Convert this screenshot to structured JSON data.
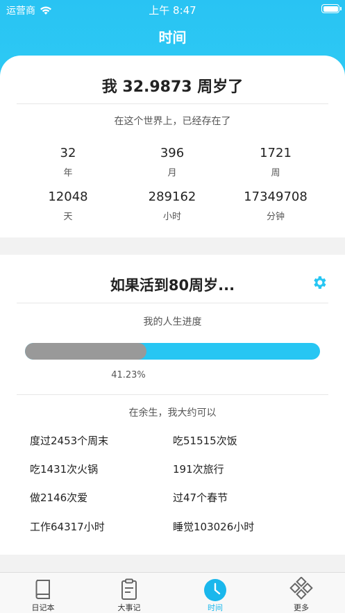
{
  "status_bar": {
    "carrier": "运营商",
    "time": "上午 8:47"
  },
  "nav": {
    "title": "时间"
  },
  "age_card": {
    "title": "我 32.9873 周岁了",
    "subtitle": "在这个世界上，已经存在了",
    "stats": [
      {
        "value": "32",
        "unit": "年"
      },
      {
        "value": "396",
        "unit": "月"
      },
      {
        "value": "1721",
        "unit": "周"
      },
      {
        "value": "12048",
        "unit": "天"
      },
      {
        "value": "289162",
        "unit": "小时"
      },
      {
        "value": "17349708",
        "unit": "分钟"
      }
    ]
  },
  "life_card": {
    "title": "如果活到80周岁...",
    "progress_label": "我的人生进度",
    "progress_percent": 41.23,
    "progress_text": "41.23%",
    "remaining_label": "在余生，我大约可以",
    "activities": [
      "度过2453个周末",
      "吃51515次饭",
      "吃1431次火锅",
      "191次旅行",
      "做2146次爱",
      "过47个春节",
      "工作64317小时",
      "睡觉103026小时"
    ]
  },
  "tabbar": {
    "tabs": [
      {
        "label": "日记本",
        "icon": "notebook-icon"
      },
      {
        "label": "大事记",
        "icon": "clipboard-icon"
      },
      {
        "label": "时间",
        "icon": "clock-icon"
      },
      {
        "label": "更多",
        "icon": "grid-diamond-icon"
      }
    ],
    "active_index": 2
  },
  "colors": {
    "accent": "#27c6f3",
    "progress_done": "#999999"
  }
}
